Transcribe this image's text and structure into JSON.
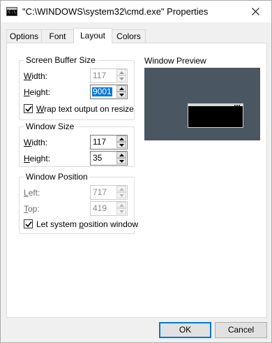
{
  "window": {
    "title": "\"C:\\WINDOWS\\system32\\cmd.exe\" Properties",
    "icon_name": "console-window-icon",
    "close_icon": "close-icon"
  },
  "tabs": [
    {
      "label": "Options",
      "active": false
    },
    {
      "label": "Font",
      "active": false
    },
    {
      "label": "Layout",
      "active": true
    },
    {
      "label": "Colors",
      "active": false
    }
  ],
  "screen_buffer": {
    "title": "Screen Buffer Size",
    "width_label_u": "W",
    "width_label_rest": "idth:",
    "width_value": "117",
    "height_label_u": "H",
    "height_label_rest": "eight:",
    "height_value": "9001",
    "wrap_label_u": "W",
    "wrap_label_rest": "rap text output on resize",
    "wrap_checked": true
  },
  "window_size": {
    "title": "Window Size",
    "width_label_u": "W",
    "width_label_rest": "idth:",
    "width_value": "117",
    "height_label_u": "H",
    "height_label_rest": "eight:",
    "height_value": "35"
  },
  "window_position": {
    "title": "Window Position",
    "left_label_u": "L",
    "left_label_rest": "eft:",
    "left_value": "717",
    "top_label_u": "T",
    "top_label_rest": "op:",
    "top_value": "419",
    "let_system_label_a": "Let system ",
    "let_system_label_u": "p",
    "let_system_label_b": "osition window",
    "let_system_checked": true
  },
  "preview": {
    "label": "Window Preview"
  },
  "buttons": {
    "ok": "OK",
    "cancel": "Cancel"
  },
  "colors": {
    "accent": "#0078d7",
    "preview_background": "#4a5661"
  }
}
